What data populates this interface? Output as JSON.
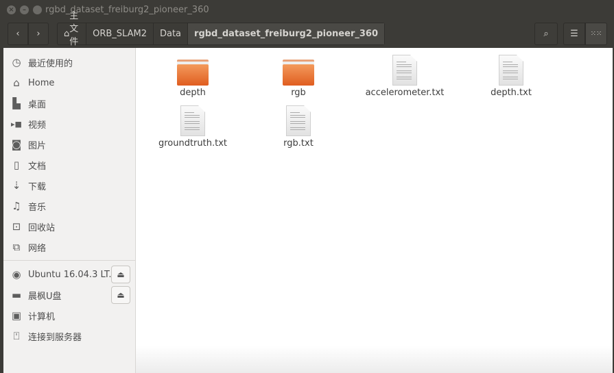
{
  "window": {
    "title": "rgbd_dataset_freiburg2_pioneer_360"
  },
  "toolbar": {
    "back_icon": "chevron-left",
    "forward_icon": "chevron-right",
    "breadcrumbs": [
      {
        "label": "主文件夹",
        "icon": "home-icon"
      },
      {
        "label": "ORB_SLAM2"
      },
      {
        "label": "Data"
      },
      {
        "label": "rgbd_dataset_freiburg2_pioneer_360"
      }
    ],
    "search_icon": "search",
    "list_view_icon": "list",
    "grid_view_icon": "grid"
  },
  "sidebar": {
    "places": [
      {
        "label": "最近使用的",
        "icon": "clock"
      },
      {
        "label": "Home",
        "icon": "home"
      },
      {
        "label": "桌面",
        "icon": "folder"
      },
      {
        "label": "视频",
        "icon": "video"
      },
      {
        "label": "图片",
        "icon": "camera"
      },
      {
        "label": "文档",
        "icon": "document"
      },
      {
        "label": "下载",
        "icon": "download"
      },
      {
        "label": "音乐",
        "icon": "music"
      },
      {
        "label": "回收站",
        "icon": "trash"
      },
      {
        "label": "网络",
        "icon": "network"
      }
    ],
    "devices": [
      {
        "label": "Ubuntu 16.04.3 LT...",
        "icon": "disc",
        "eject": true
      },
      {
        "label": "晨枫U盘",
        "icon": "drive",
        "eject": true
      },
      {
        "label": "计算机",
        "icon": "computer"
      },
      {
        "label": "连接到服务器",
        "icon": "server"
      }
    ]
  },
  "files": [
    {
      "name": "depth",
      "type": "folder"
    },
    {
      "name": "rgb",
      "type": "folder"
    },
    {
      "name": "accelerometer.txt",
      "type": "text"
    },
    {
      "name": "depth.txt",
      "type": "text"
    },
    {
      "name": "groundtruth.txt",
      "type": "text"
    },
    {
      "name": "rgb.txt",
      "type": "text"
    }
  ],
  "colors": {
    "folder": "#e8622a",
    "chrome": "#3c3b37",
    "sidebar": "#f2f1f0"
  }
}
